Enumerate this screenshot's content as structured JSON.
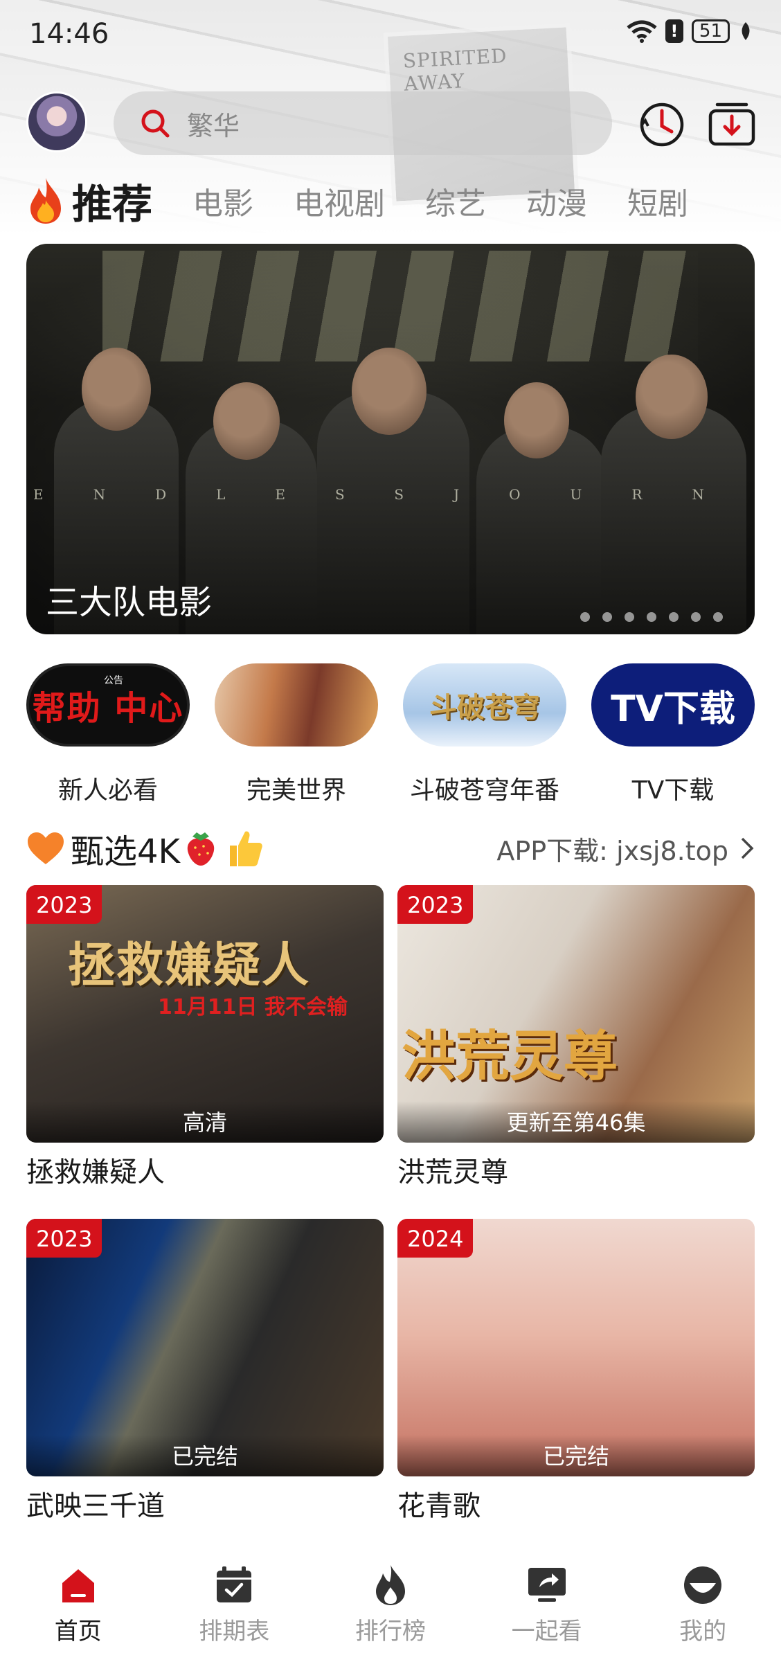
{
  "status_bar": {
    "time": "14:46",
    "battery": "51"
  },
  "header": {
    "search": {
      "placeholder": "繁华"
    },
    "background_text": "SPIRITED AWAY"
  },
  "tabs": [
    {
      "label": "推荐",
      "active": true
    },
    {
      "label": "电影"
    },
    {
      "label": "电视剧"
    },
    {
      "label": "综艺"
    },
    {
      "label": "动漫"
    },
    {
      "label": "短剧"
    }
  ],
  "banner": {
    "title": "三大队电影",
    "overlay_text": "ENDLESSJOURNEY",
    "slide_count": 7
  },
  "portals": [
    {
      "label": "新人必看",
      "image_text": "帮助 中心",
      "tag": "公告"
    },
    {
      "label": "完美世界"
    },
    {
      "label": "斗破苍穹年番",
      "image_text": "斗破苍穹"
    },
    {
      "label": "TV下载",
      "image_text": "TV下载"
    }
  ],
  "section": {
    "title": "甄选4K",
    "link": "APP下载: jxsj8.top"
  },
  "cards": [
    {
      "year": "2023",
      "badge": "高清",
      "name": "拯救嫌疑人",
      "poster_title": "拯救嫌疑人",
      "poster_sub": "11月11日 我不会输"
    },
    {
      "year": "2023",
      "badge": "更新至第46集",
      "name": "洪荒灵尊",
      "poster_title": "洪荒灵尊"
    },
    {
      "year": "2023",
      "badge": "已完结",
      "name": "武映三千道"
    },
    {
      "year": "2024",
      "badge": "已完结",
      "name": "花青歌"
    }
  ],
  "bottom_nav": [
    {
      "label": "首页",
      "icon": "home-icon",
      "active": true
    },
    {
      "label": "排期表",
      "icon": "calendar-icon"
    },
    {
      "label": "排行榜",
      "icon": "flame-icon"
    },
    {
      "label": "一起看",
      "icon": "watch-together-icon"
    },
    {
      "label": "我的",
      "icon": "profile-icon"
    }
  ],
  "colors": {
    "accent": "#d4121b",
    "nav_inactive": "#9a9a9a",
    "tab_inactive": "#888888"
  }
}
